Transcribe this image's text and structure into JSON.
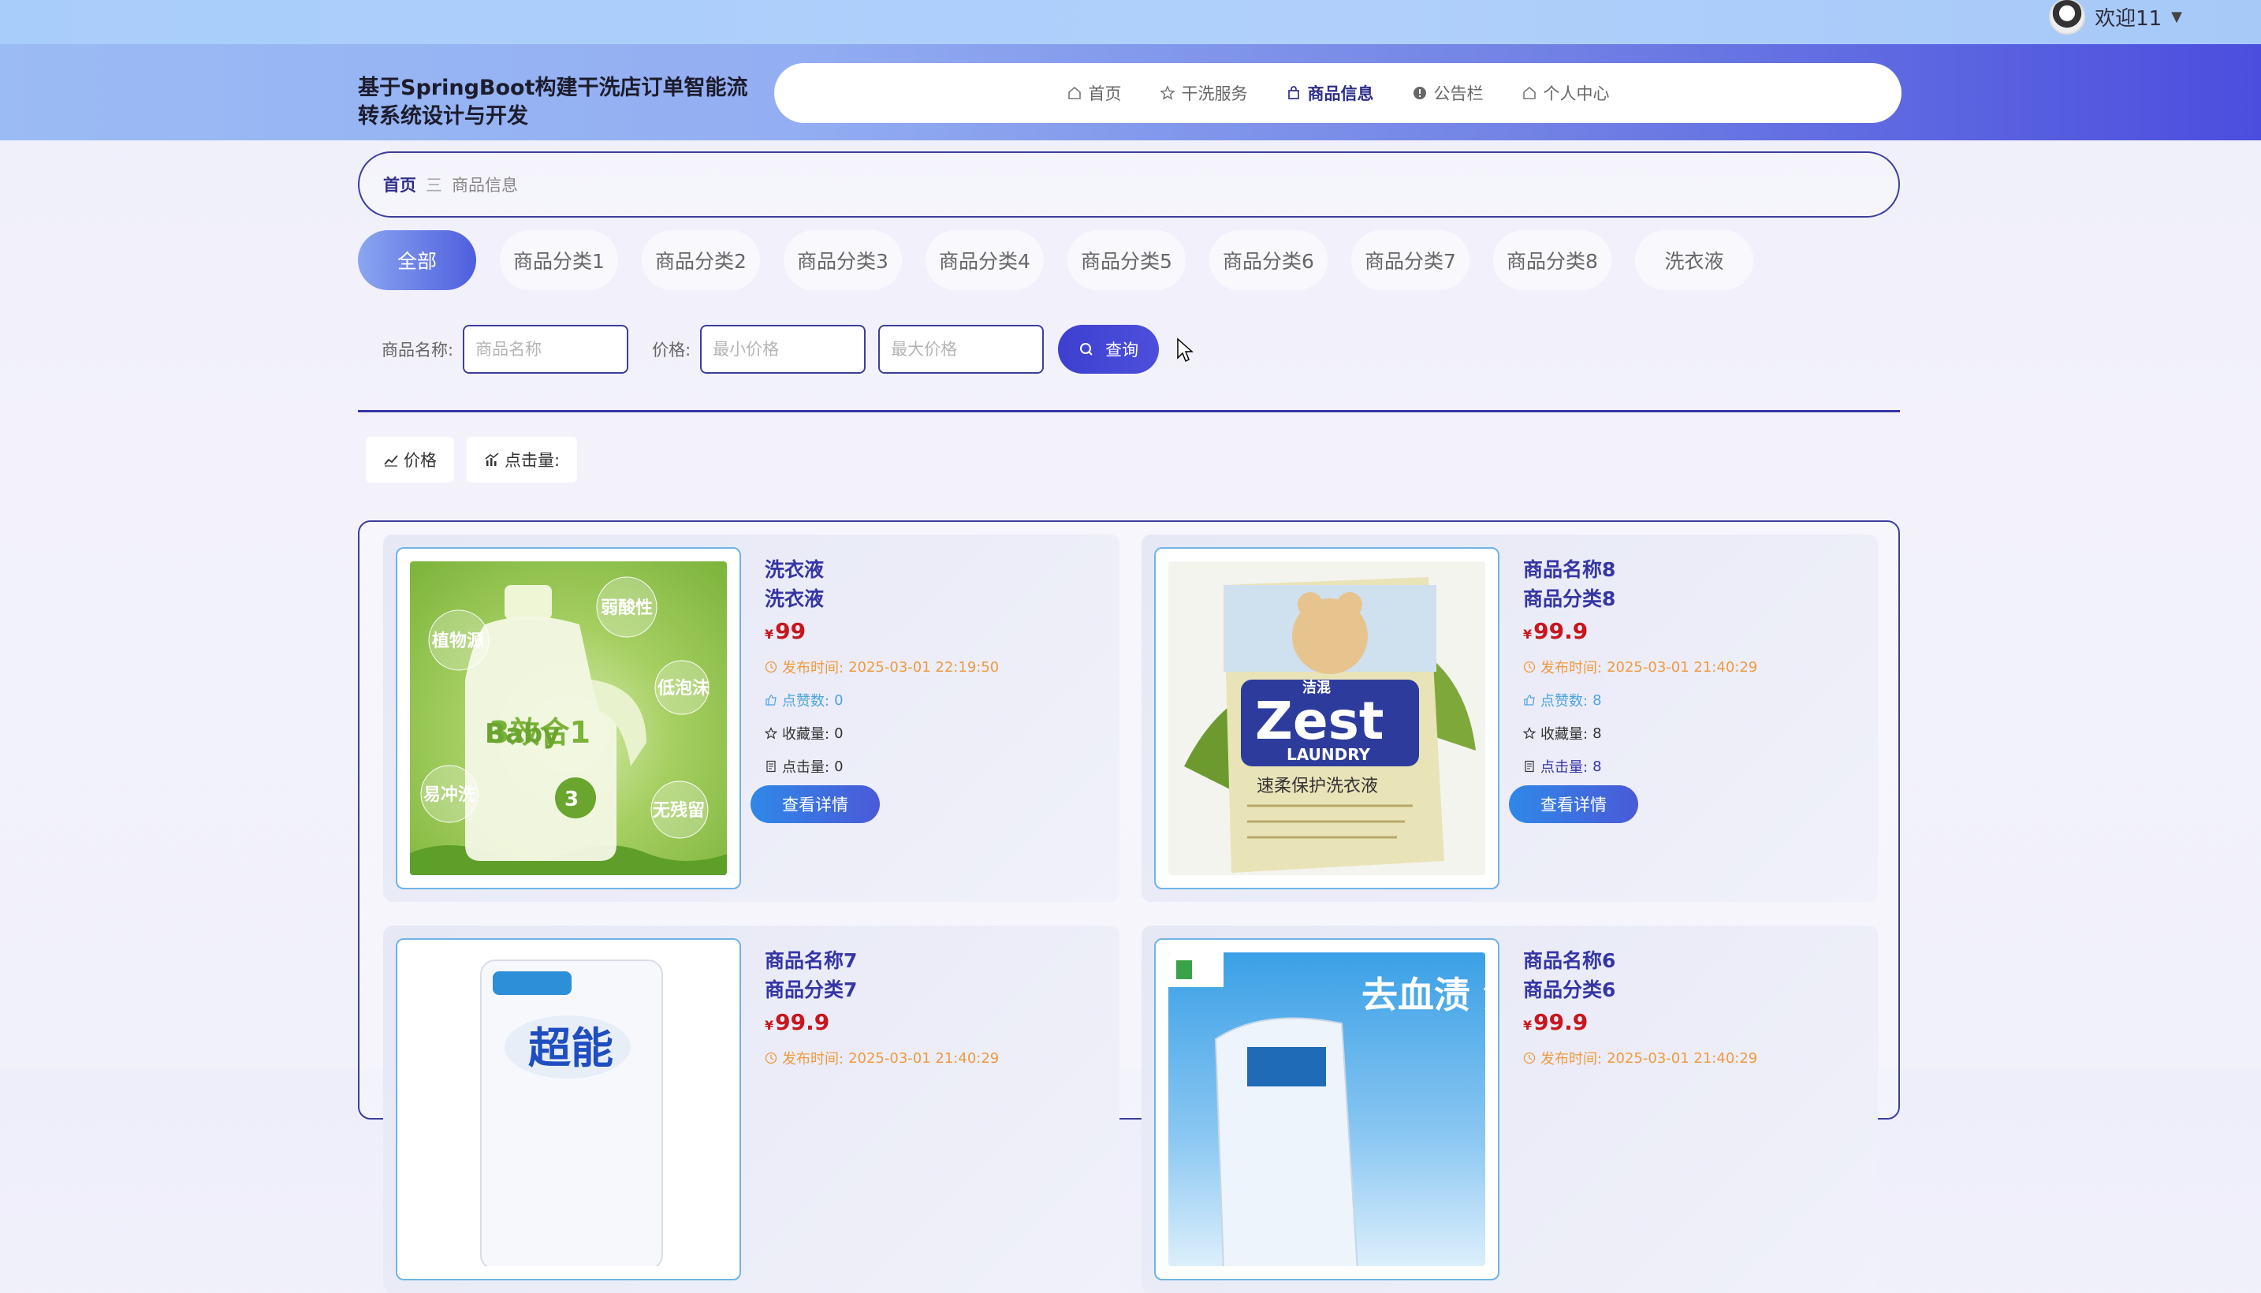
{
  "user": {
    "greeting": "欢迎11"
  },
  "header": {
    "site_title": "基于SpringBoot构建干洗店订单智能流转系统设计与开发"
  },
  "nav": [
    {
      "label": "首页",
      "icon": "home-icon",
      "active": false
    },
    {
      "label": "干洗服务",
      "icon": "star-icon",
      "active": false
    },
    {
      "label": "商品信息",
      "icon": "bag-icon",
      "active": true
    },
    {
      "label": "公告栏",
      "icon": "info-icon",
      "active": false
    },
    {
      "label": "个人中心",
      "icon": "home-icon",
      "active": false
    }
  ],
  "breadcrumb": {
    "home": "首页",
    "separator": "三",
    "current": "商品信息"
  },
  "categories": [
    "全部",
    "商品分类1",
    "商品分类2",
    "商品分类3",
    "商品分类4",
    "商品分类5",
    "商品分类6",
    "商品分类7",
    "商品分类8",
    "洗衣液"
  ],
  "search": {
    "name_label": "商品名称:",
    "name_placeholder": "商品名称",
    "price_label": "价格:",
    "min_placeholder": "最小价格",
    "max_placeholder": "最大价格",
    "button_label": "查询"
  },
  "sorts": {
    "price": "价格",
    "clicks": "点击量:"
  },
  "labels": {
    "currency": "¥",
    "time_prefix": "发布时间:",
    "likes_prefix": "点赞数:",
    "favs_prefix": "收藏量:",
    "clicks_prefix": "点击量:",
    "detail_button": "查看详情"
  },
  "products": [
    {
      "name": "洗衣液",
      "category": "洗衣液",
      "price": "99",
      "time": "2025-03-01 22:19:50",
      "likes": "0",
      "favs": "0",
      "clicks": "0",
      "image_text": "Baby"
    },
    {
      "name": "商品名称8",
      "category": "商品分类8",
      "price": "99.9",
      "time": "2025-03-01 21:40:29",
      "likes": "8",
      "favs": "8",
      "clicks": "8",
      "image_text": "Zest"
    },
    {
      "name": "商品名称7",
      "category": "商品分类7",
      "price": "99.9",
      "time": "2025-03-01 21:40:29",
      "image_text": "超能"
    },
    {
      "name": "商品名称6",
      "category": "商品分类6",
      "price": "99.9",
      "time": "2025-03-01 21:40:29",
      "image_text": "去血渍 洗衣"
    }
  ],
  "image_labels": {
    "baby_bubbles": [
      "植物源",
      "弱酸性",
      "低泡沫",
      "易冲洗",
      "无残留"
    ],
    "baby_badge": "3效合1",
    "zest_sub": "LAUNDRY",
    "zest_cn": "速柔保护洗衣液",
    "zest_brand": "洁混"
  },
  "colors": {
    "accent": "#3d3fcf",
    "price": "#c8161d",
    "title": "#3536a4"
  }
}
